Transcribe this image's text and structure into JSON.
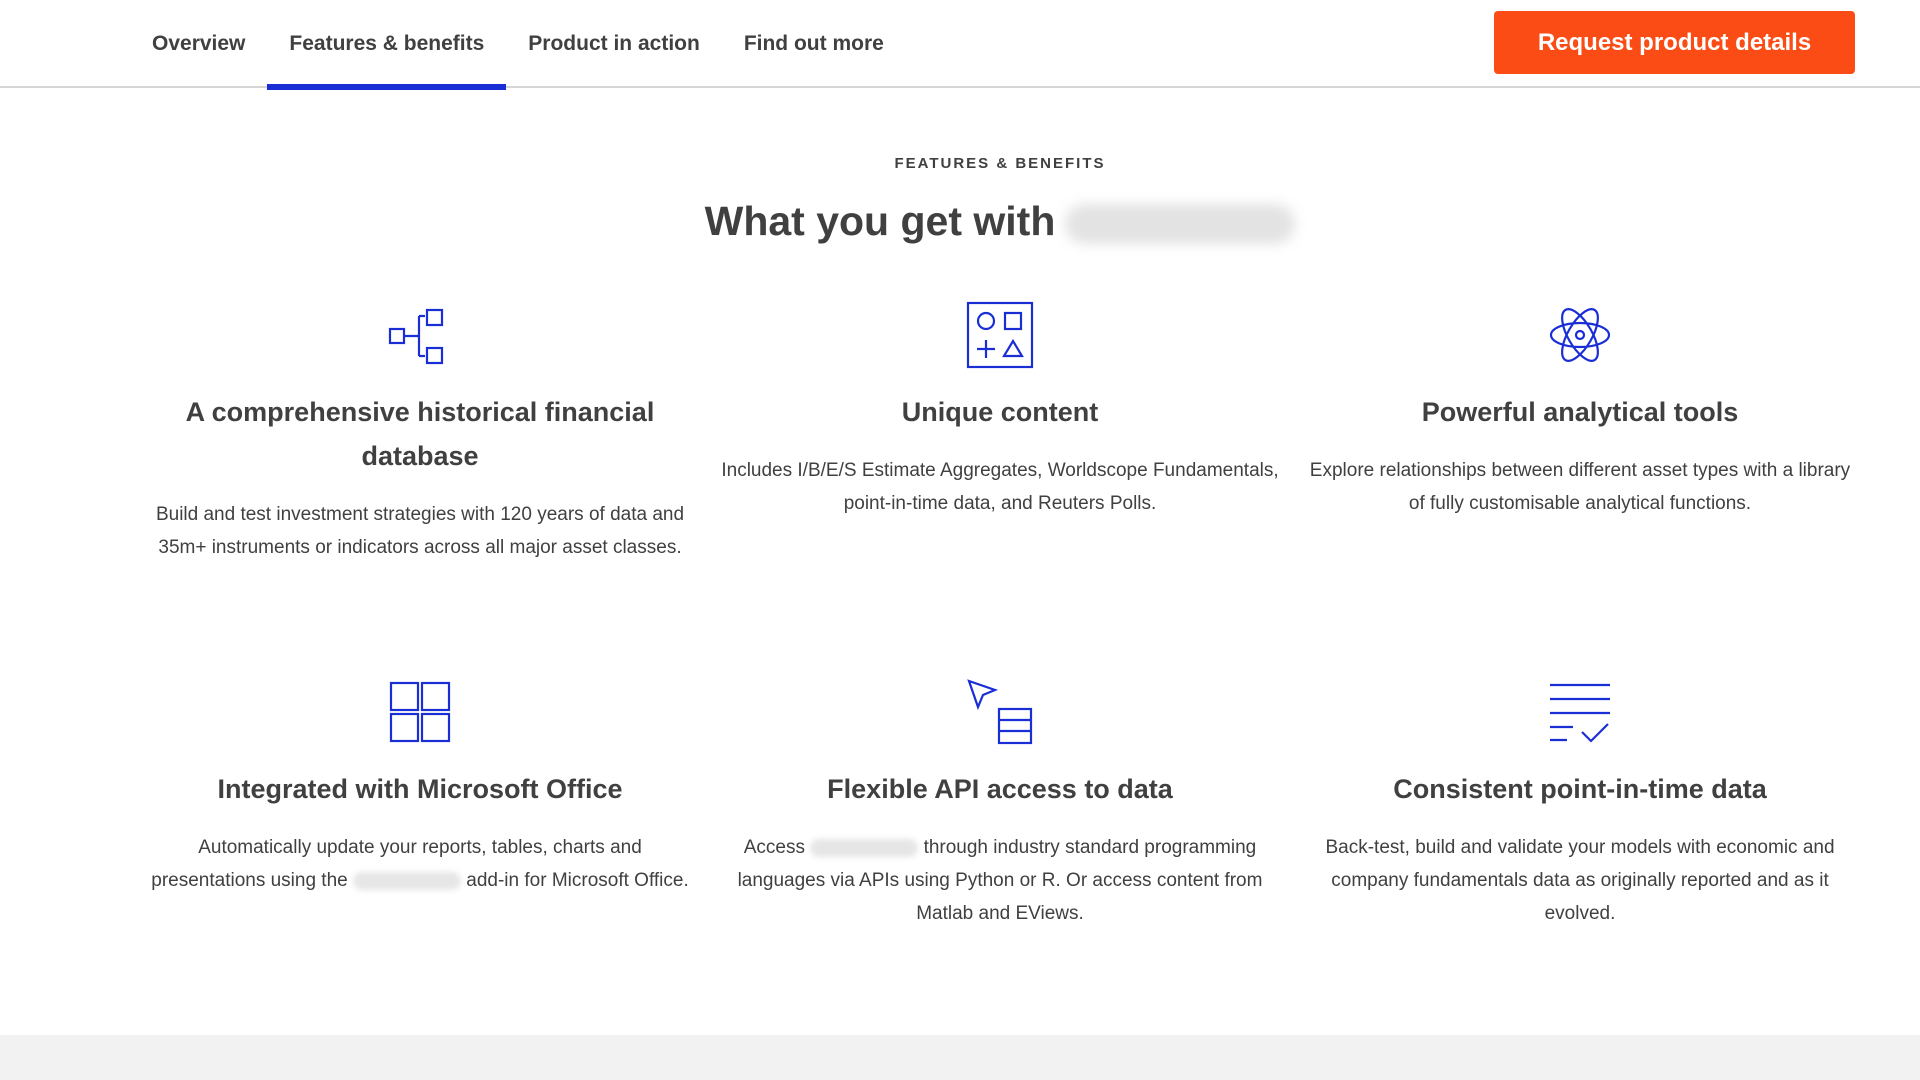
{
  "nav": {
    "tabs": [
      "Overview",
      "Features & benefits",
      "Product in action",
      "Find out more"
    ],
    "active_tab": "Features & benefits",
    "cta_label": "Request product details"
  },
  "section": {
    "eyebrow": "FEATURES & BENEFITS",
    "heading": "What you get with"
  },
  "features": [
    {
      "icon": "hierarchy-icon",
      "title": "A comprehensive historical financial database",
      "body": "Build and test investment strategies with 120 years of data and 35m+ instruments or indicators across all major asset classes."
    },
    {
      "icon": "shapes-icon",
      "title": "Unique content",
      "body": "Includes I/B/E/S Estimate Aggregates, Worldscope Fundamentals, point-in-time data, and Reuters Polls."
    },
    {
      "icon": "atom-icon",
      "title": "Powerful analytical tools",
      "body": "Explore relationships between different asset types with a library of fully customisable analytical functions."
    },
    {
      "icon": "grid-icon",
      "title": "Integrated with Microsoft Office",
      "body_pre": "Automatically update your reports, tables, charts and presentations using the",
      "body_post": "add-in for Microsoft Office."
    },
    {
      "icon": "cursor-table-icon",
      "title": "Flexible API access to data",
      "body_pre": "Access",
      "body_post": "through industry standard programming languages via APIs using Python or R. Or access content from Matlab and EViews."
    },
    {
      "icon": "checklist-icon",
      "title": "Consistent point-in-time data",
      "body": "Back-test, build and validate your models with economic and company fundamentals data as originally reported and as it evolved."
    }
  ],
  "colors": {
    "accent_blue": "#1a2ed6",
    "cta_orange": "#fa4c14",
    "text": "#404040",
    "footer_band": "#f2f2f2"
  }
}
